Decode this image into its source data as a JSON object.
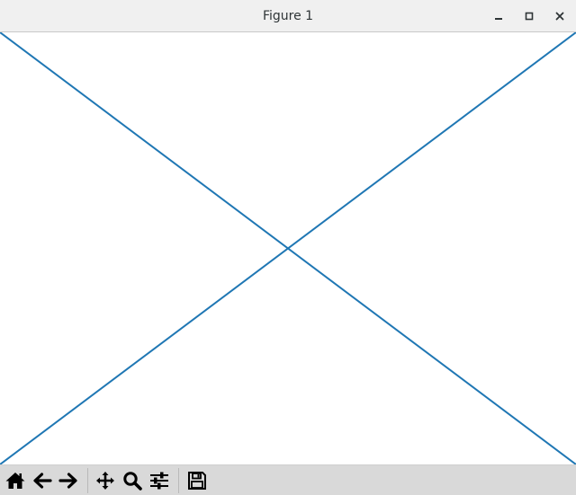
{
  "window": {
    "title": "Figure 1",
    "controls": {
      "minimize": "minimize-icon",
      "maximize": "maximize-icon",
      "close": "close-icon"
    }
  },
  "toolbar": {
    "buttons": [
      "home-icon",
      "back-arrow-icon",
      "forward-arrow-icon",
      "pan-icon",
      "zoom-icon",
      "configure-subplots-icon",
      "save-icon"
    ]
  },
  "colors": {
    "line": "#1f77b4",
    "toolbar_bg": "#d9d9d9",
    "titlebar_bg": "#f0f0f0"
  },
  "chart_data": {
    "type": "line",
    "series": [
      {
        "x": [
          0,
          1
        ],
        "y": [
          0,
          1
        ]
      },
      {
        "x": [
          0,
          1
        ],
        "y": [
          1,
          0
        ]
      }
    ],
    "xlim": [
      0,
      1
    ],
    "ylim": [
      0,
      1
    ],
    "grid": false,
    "axes_visible": false
  }
}
